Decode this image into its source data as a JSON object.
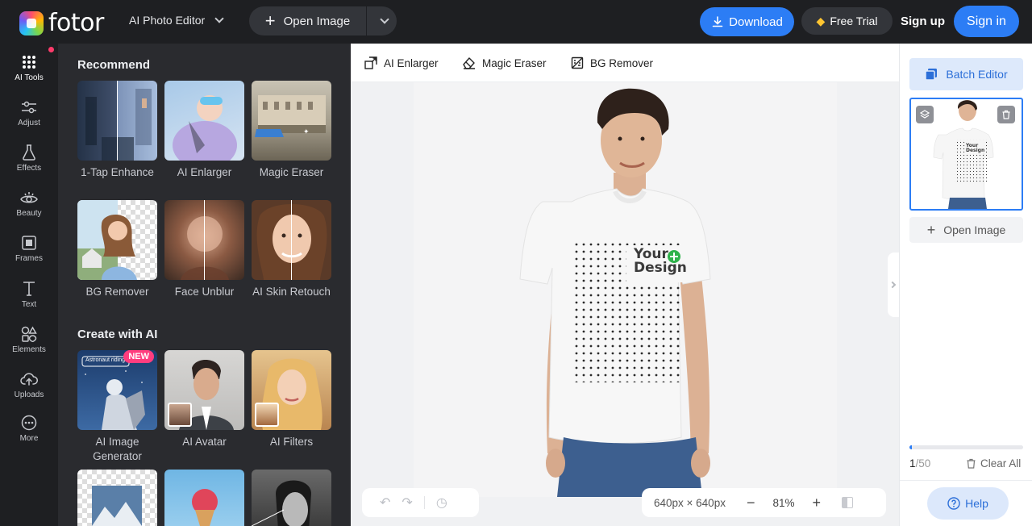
{
  "topbar": {
    "logo_text": "fotor",
    "app_switch_label": "AI Photo Editor",
    "open_image_label": "Open Image",
    "download_label": "Download",
    "free_trial_label": "Free Trial",
    "sign_up_label": "Sign up",
    "sign_in_label": "Sign in"
  },
  "rail": {
    "items": [
      {
        "label": "AI Tools",
        "icon": "grid-dots-icon"
      },
      {
        "label": "Adjust",
        "icon": "sliders-icon"
      },
      {
        "label": "Effects",
        "icon": "flask-icon"
      },
      {
        "label": "Beauty",
        "icon": "eye-icon"
      },
      {
        "label": "Frames",
        "icon": "frame-icon"
      },
      {
        "label": "Text",
        "icon": "text-icon"
      },
      {
        "label": "Elements",
        "icon": "shapes-icon"
      },
      {
        "label": "Uploads",
        "icon": "cloud-upload-icon"
      },
      {
        "label": "More",
        "icon": "more-dots-icon"
      }
    ]
  },
  "panel": {
    "recommend_title": "Recommend",
    "create_title": "Create with AI",
    "recommend_cards": [
      {
        "label": "1-Tap Enhance"
      },
      {
        "label": "AI Enlarger"
      },
      {
        "label": "Magic Eraser"
      },
      {
        "label": "BG Remover"
      },
      {
        "label": "Face Unblur"
      },
      {
        "label": "AI Skin Retouch"
      }
    ],
    "create_cards": [
      {
        "label": "AI Image Generator",
        "badge": "NEW",
        "thumb_caption": "Astronaut riding a"
      },
      {
        "label": "AI Avatar"
      },
      {
        "label": "AI Filters"
      }
    ]
  },
  "toolbar": {
    "tools": [
      {
        "label": "AI Enlarger",
        "icon": "enlarge-icon"
      },
      {
        "label": "Magic Eraser",
        "icon": "eraser-icon"
      },
      {
        "label": "BG Remover",
        "icon": "bg-remove-icon"
      }
    ]
  },
  "canvas": {
    "design_text_line1": "Your",
    "design_text_line2": "Design",
    "dimensions": "640px × 640px",
    "zoom": "81%"
  },
  "right_panel": {
    "batch_editor_label": "Batch Editor",
    "open_image_label": "Open Image",
    "count_current": "1",
    "count_total": "/50",
    "progress": 0.02,
    "clear_all_label": "Clear All",
    "help_label": "Help"
  },
  "colors": {
    "accent": "#2c7df5",
    "dark_bg": "#1e1f22",
    "panel_bg": "#2a2b2f",
    "new_badge": "#ff3d7f"
  }
}
